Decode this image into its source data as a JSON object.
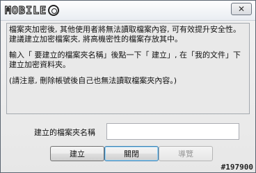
{
  "title_bar": {
    "logo_text": "MOBILE",
    "close_symbol": "✕"
  },
  "message": {
    "lines": [
      "檔案夾加密後, 其他使用者將無法讀取檔案內容, 可有效提升安全性。",
      "建議建立加密檔案夾, 將高機密性的檔案存放其中。",
      "輸入「 要建立的檔案夾名稱」後點一下「 建立」, 在「我的文件」下建立加密資料夾。",
      "(請注意, 刪除帳號後自己也無法讀取檔案夾內容。)"
    ]
  },
  "form": {
    "folder_name_label": "建立的檔案夾名稱",
    "folder_name_value": ""
  },
  "buttons": {
    "create": "建立",
    "close": "關閉",
    "navigate": "導覽"
  },
  "watermark": "#197900"
}
